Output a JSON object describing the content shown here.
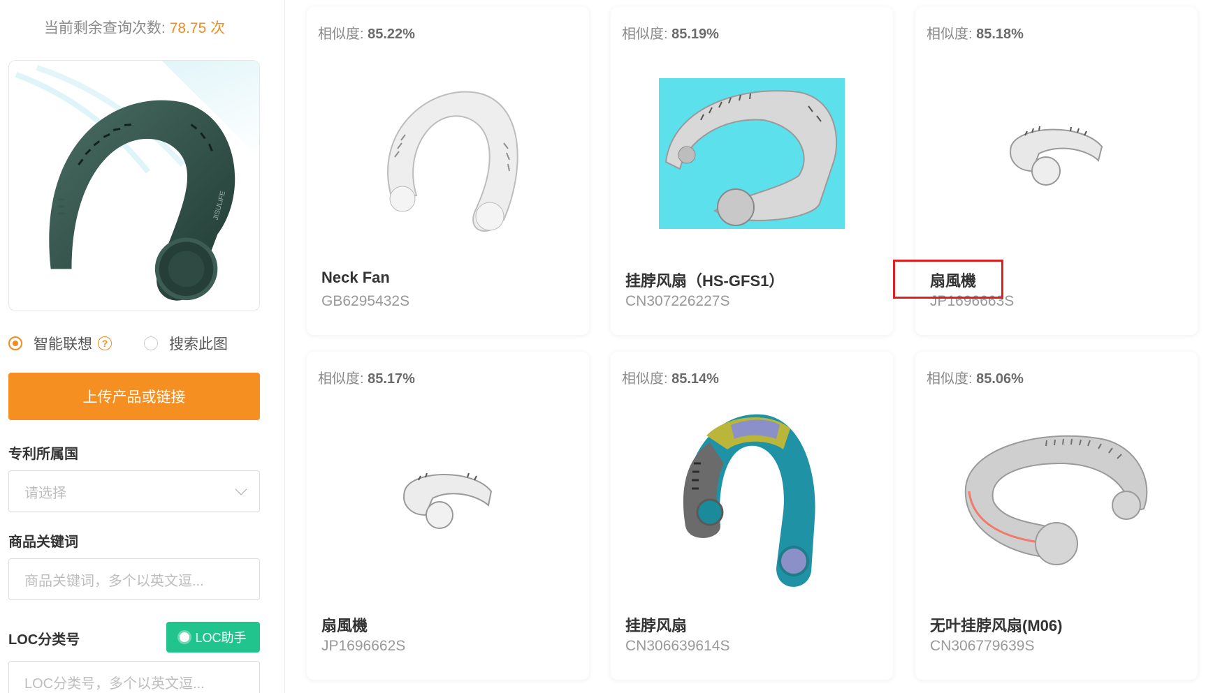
{
  "quota": {
    "label": "当前剩余查询次数:",
    "value": "78.75 次"
  },
  "preview": {
    "alt": "JISULIFE neck fan",
    "brand_text": "JISULIFE"
  },
  "modes": {
    "smart": "智能联想",
    "help": "?",
    "search": "搜索此图"
  },
  "upload_label": "上传产品或链接",
  "filters": {
    "country_label": "专利所属国",
    "country_placeholder": "请选择",
    "keyword_label": "商品关键词",
    "keyword_placeholder": "商品关键词，多个以英文逗...",
    "loc_label": "LOC分类号",
    "loc_button": "LOC助手",
    "loc_placeholder": "LOC分类号，多个以英文逗..."
  },
  "results": [
    {
      "similarity_label": "相似度:",
      "similarity": "85.22%",
      "title": "Neck Fan",
      "code": "GB6295432S"
    },
    {
      "similarity_label": "相似度:",
      "similarity": "85.19%",
      "title": "挂脖风扇（HS-GFS1）",
      "code": "CN307226227S"
    },
    {
      "similarity_label": "相似度:",
      "similarity": "85.18%",
      "title": "扇風機",
      "code": "JP1696663S"
    },
    {
      "similarity_label": "相似度:",
      "similarity": "85.17%",
      "title": "扇風機",
      "code": "JP1696662S"
    },
    {
      "similarity_label": "相似度:",
      "similarity": "85.14%",
      "title": "挂脖风扇",
      "code": "CN306639614S"
    },
    {
      "similarity_label": "相似度:",
      "similarity": "85.06%",
      "title": "无叶挂脖风扇(M06)",
      "code": "CN306779639S"
    }
  ],
  "colors": {
    "accent": "#f68f22",
    "loc_green": "#21c48c",
    "highlight": "#e02020"
  }
}
